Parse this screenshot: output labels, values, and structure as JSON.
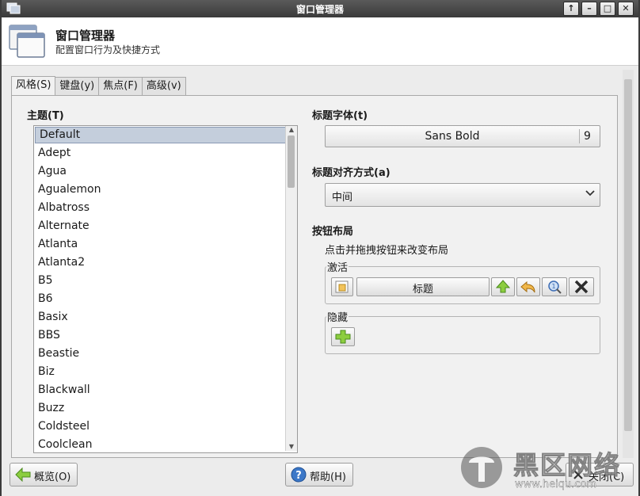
{
  "window": {
    "title": "窗口管理器"
  },
  "titlebar_buttons": [
    "↑",
    "–",
    "□",
    "✕"
  ],
  "header": {
    "title": "窗口管理器",
    "subtitle": "配置窗口行为及快捷方式"
  },
  "tabs": [
    {
      "label": "风格(S)",
      "active": true
    },
    {
      "label": "键盘(y)",
      "active": false
    },
    {
      "label": "焦点(F)",
      "active": false
    },
    {
      "label": "高级(v)",
      "active": false
    }
  ],
  "theme": {
    "label": "主题(T)",
    "items": [
      "Default",
      "Adept",
      "Agua",
      "Agualemon",
      "Albatross",
      "Alternate",
      "Atlanta",
      "Atlanta2",
      "B5",
      "B6",
      "Basix",
      "BBS",
      "Beastie",
      "Biz",
      "Blackwall",
      "Buzz",
      "Coldsteel",
      "Coolclean"
    ],
    "selected": "Default"
  },
  "title_font": {
    "label": "标题字体(t)",
    "font_name": "Sans Bold",
    "font_size": "9"
  },
  "title_align": {
    "label": "标题对齐方式(a)",
    "value": "中间"
  },
  "button_layout": {
    "label": "按钮布局",
    "note": "点击并拖拽按钮来改变布局",
    "active_label": "激活",
    "title_button": "标题",
    "hidden_label": "隐藏"
  },
  "footer": {
    "overview_button": "概览(O)",
    "help_button": "帮助(H)",
    "close_button": "关闭(C)"
  },
  "watermark": {
    "text": "黑区网络",
    "url": "www.heiqu.com"
  },
  "colors": {
    "titlebar": "#3a3a3a",
    "selection": "#c4cedc",
    "accent_green": "#7cc242",
    "help_blue": "#3c78c8"
  }
}
